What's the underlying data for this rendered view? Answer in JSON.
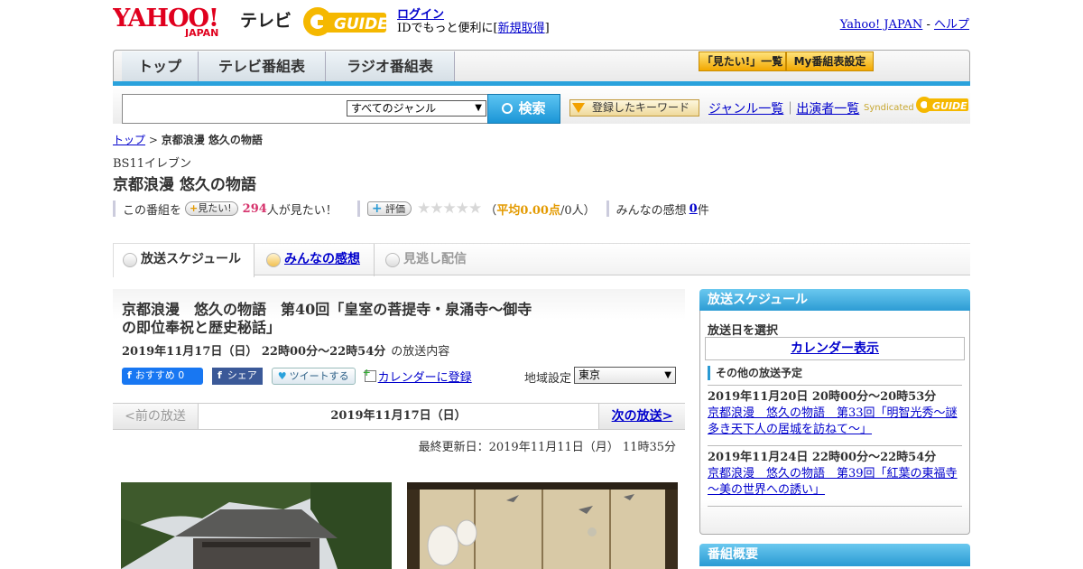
{
  "header": {
    "logo_yahoo": "YAHOO!",
    "logo_japan": "JAPAN",
    "logo_tv": "テレビ",
    "logo_gguide": "GUIDE",
    "login": "ログイン",
    "id_text": "IDでもっと便利に[",
    "register": "新規取得",
    "id_close": "]",
    "yahoo_japan": "Yahoo! JAPAN",
    "sep": " - ",
    "help": "ヘルプ"
  },
  "nav": {
    "tabs": [
      "トップ",
      "テレビ番組表",
      "ラジオ番組表"
    ],
    "mitai_list": "「見たい!」一覧",
    "my_schedule": "My番組表設定"
  },
  "search": {
    "genre_selected": "すべてのジャンル",
    "search_btn": "検索",
    "keyword_btn": "登録したキーワード",
    "genre_list": "ジャンル一覧",
    "divider": "｜",
    "performer_list": "出演者一覧",
    "syndicated": "Syndicated",
    "gguide": "GUIDE"
  },
  "breadcrumb": {
    "top": "トップ",
    "sep": " > ",
    "current": "京都浪漫 悠久の物語"
  },
  "program": {
    "station": "BS11イレブン",
    "title": "京都浪漫 悠久の物語",
    "kono": "この番組を",
    "mitai_btn": "見たい!",
    "mitai_count": "294",
    "mitai_suffix": "人が見たい！",
    "rating_btn": "評価",
    "rating_open": "（",
    "rating_avg": "平均0.00点",
    "rating_people": "/0人）",
    "impressions_label": "みんなの感想",
    "impressions_count": "0",
    "impressions_suffix": "件"
  },
  "tabs": {
    "schedule": "放送スケジュール",
    "reviews": "みんなの感想",
    "missed": "見逃し配信"
  },
  "episode": {
    "title": "京都浪漫　悠久の物語　第40回「皇室の菩提寺・泉涌寺～御寺の即位奉祝と歴史秘話」",
    "datetime": "2019年11月17日（日）  22時00分～22時54分",
    "suffix": "の放送内容",
    "fb_recommend": "おすすめ 0",
    "fb_share": "シェア",
    "tweet": "ツイートする",
    "calendar_add": "カレンダーに登録",
    "region_label": "地域設定",
    "region_value": "東京",
    "prev": "<前の放送",
    "current_date": "2019年11月17日（日）",
    "next": "次の放送>",
    "updated": "最終更新日：2019年11月11日（月） 11時35分"
  },
  "sidebar": {
    "schedule_head": "放送スケジュール",
    "pick_date": "放送日を選択",
    "calendar_btn": "カレンダー表示",
    "other_head": "その他の放送予定",
    "others": [
      {
        "date": "2019年11月20日  20時00分～20時53分",
        "title": "京都浪漫　悠久の物語　第33回「明智光秀～謎多き天下人の居城を訪ねて～」"
      },
      {
        "date": "2019年11月24日  22時00分～22時54分",
        "title": "京都浪漫　悠久の物語　第39回「紅葉の東福寺～美の世界への誘い」"
      }
    ],
    "overview_head": "番組概要"
  },
  "colors": {
    "accent_blue": "#2aa2dc",
    "link": "#0000cc",
    "mitai_count": "#d6336c",
    "rating_avg": "#e39a00"
  }
}
